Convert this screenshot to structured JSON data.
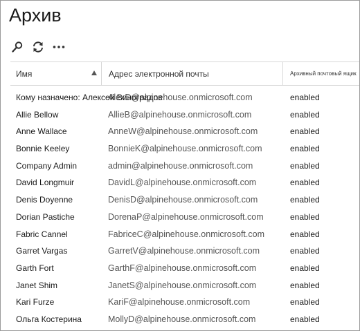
{
  "page": {
    "title": "Архив"
  },
  "toolbar": {
    "search_icon": "search-icon",
    "refresh_icon": "refresh-icon",
    "more_icon": "more-icon"
  },
  "table": {
    "headers": {
      "name": "Имя",
      "email": "Адрес электронной почты",
      "archive": "Архивный почтовый ящик"
    },
    "rows": [
      {
        "name": "Кому назначено: Алексей Виноградов",
        "email": "AlexD@alpinehouse.onmicrosoft.com",
        "status": "enabled"
      },
      {
        "name": "Allie Bellow",
        "email": "AllieB@alpinehouse.onmicrosoft.com",
        "status": "enabled"
      },
      {
        "name": "Anne Wallace",
        "email": "AnneW@alpinehouse.onmicrosoft.com",
        "status": "enabled"
      },
      {
        "name": "Bonnie Keeley",
        "email": "BonnieK@alpinehouse.onmicrosoft.com",
        "status": "enabled"
      },
      {
        "name": "Company Admin",
        "email": "admin@alpinehouse.onmicrosoft.com",
        "status": "enabled"
      },
      {
        "name": "David Longmuir",
        "email": "DavidL@alpinehouse.onmicrosoft.com",
        "status": "enabled"
      },
      {
        "name": "Denis Doyenne",
        "email": "DenisD@alpinehouse.onmicrosoft.com",
        "status": "enabled"
      },
      {
        "name": "Dorian Pastiche",
        "email": "DorenaP@alpinehouse.onmicrosoft.com",
        "status": "enabled"
      },
      {
        "name": "Fabric Cannel",
        "email": "FabriceC@alpinehouse.onmicrosoft.com",
        "status": "enabled"
      },
      {
        "name": "Garret Vargas",
        "email": "GarretV@alpinehouse.onmicrosoft.com",
        "status": "enabled"
      },
      {
        "name": "Garth Fort",
        "email": "GarthF@alpinehouse.onmicrosoft.com",
        "status": "enabled"
      },
      {
        "name": "Janet Shim",
        "email": "JanetS@alpinehouse.onmicrosoft.com",
        "status": "enabled"
      },
      {
        "name": "Kari Furze",
        "email": "KariF@alpinehouse.onmicrosoft.com",
        "status": "enabled"
      },
      {
        "name": "Ольга Костерина",
        "email": "MollyD@alpinehouse.onmicrosoft.com",
        "status": "enabled"
      }
    ]
  }
}
